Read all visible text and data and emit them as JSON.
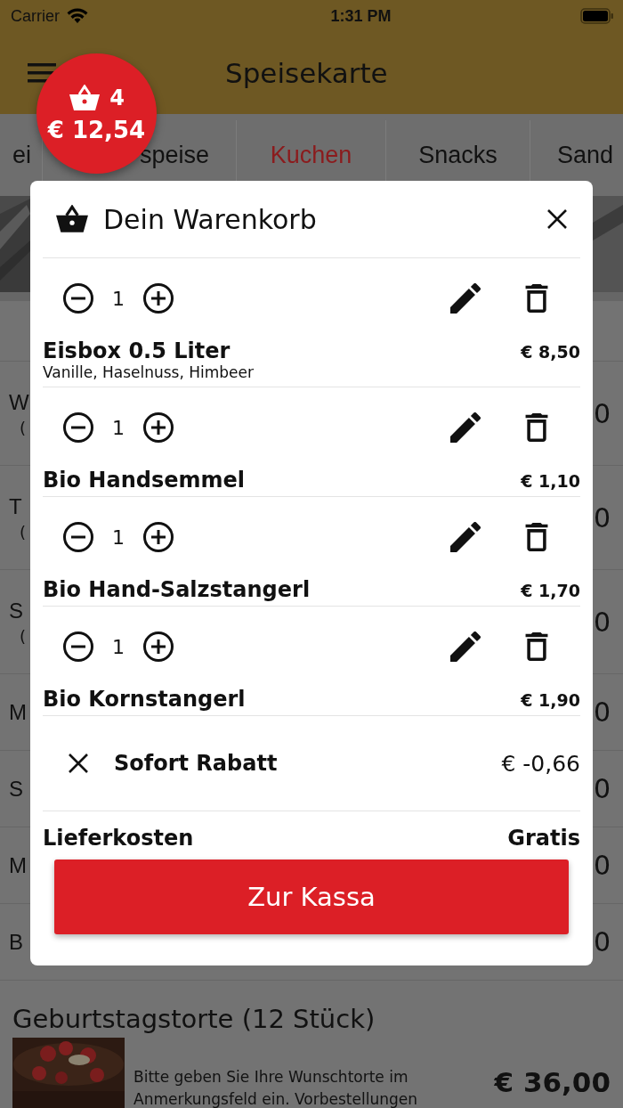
{
  "status_bar": {
    "carrier": "Carrier",
    "time": "1:31 PM"
  },
  "app_bar": {
    "title": "Speisekarte"
  },
  "cart_badge": {
    "count": "4",
    "total": "€ 12,54"
  },
  "tabs": [
    {
      "label": "ei",
      "selected": false
    },
    {
      "label": "speise",
      "selected": false
    },
    {
      "label": "Kuchen",
      "selected": true
    },
    {
      "label": "Snacks",
      "selected": false
    },
    {
      "label": "Sand",
      "selected": false
    }
  ],
  "menu_rows": [
    {
      "name": "W",
      "note": "(",
      "price": "0"
    },
    {
      "name": "T",
      "note": "(",
      "price": "0"
    },
    {
      "name": "S",
      "note": "(",
      "price": "0"
    },
    {
      "name": "M",
      "price": "0"
    },
    {
      "name": "S",
      "price": "0"
    },
    {
      "name": "M",
      "price": "0"
    },
    {
      "name": "B",
      "price": "0"
    }
  ],
  "featured": {
    "name": "Geburtstagstorte (12 Stück)",
    "description": "Bitte geben Sie Ihre Wunschtorte im Anmerkungsfeld ein. Vorbestellungen",
    "price": "€ 36,00"
  },
  "cart": {
    "title": "Dein Warenkorb",
    "items": [
      {
        "quantity": "1",
        "name": "Eisbox 0.5 Liter",
        "options": "Vanille, Haselnuss, Himbeer",
        "price": "€ 8,50"
      },
      {
        "quantity": "1",
        "name": "Bio Handsemmel",
        "price": "€ 1,10"
      },
      {
        "quantity": "1",
        "name": "Bio Hand-Salzstangerl",
        "price": "€ 1,70"
      },
      {
        "quantity": "1",
        "name": "Bio Kornstangerl",
        "price": "€ 1,90"
      }
    ],
    "discount": {
      "label": "Sofort Rabatt",
      "amount": "€ -0,66"
    },
    "delivery": {
      "label": "Lieferkosten",
      "value": "Gratis"
    },
    "checkout_button": "Zur Kassa"
  }
}
